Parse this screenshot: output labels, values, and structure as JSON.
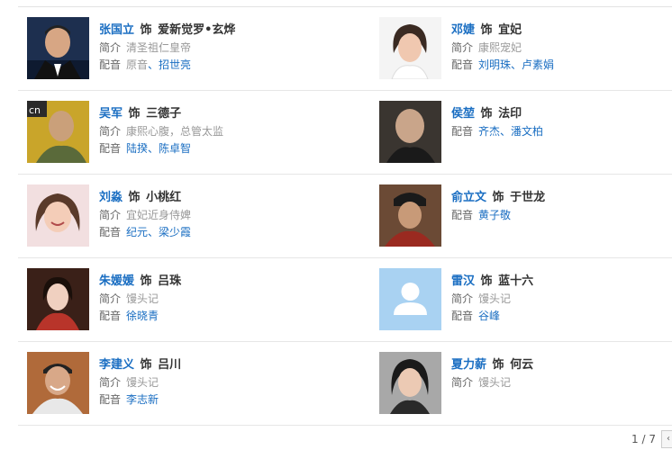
{
  "cast": [
    {
      "actor": "张国立",
      "role": "爱新觉罗•玄烨",
      "intro": "清圣祖仁皇帝",
      "voices": [
        "原音",
        "招世亮"
      ],
      "voice_first_plain": true,
      "avatar": "photo-man-suit"
    },
    {
      "actor": "邓婕",
      "role": "宜妃",
      "intro": "康熙宠妃",
      "voices": [
        "刘明珠",
        "卢素娟"
      ],
      "avatar": "photo-woman-short-hair"
    },
    {
      "actor": "吴军",
      "role": "三德子",
      "intro": "康熙心腹，总管太监",
      "voices": [
        "陆揆",
        "陈卓智"
      ],
      "avatar": "photo-bald-man-logo"
    },
    {
      "actor": "侯堃",
      "role": "法印",
      "intro": "",
      "voices": [
        "齐杰",
        "潘文柏"
      ],
      "avatar": "photo-bald-man-dark"
    },
    {
      "actor": "刘淼",
      "role": "小桃红",
      "intro": "宜妃近身侍婢",
      "voices": [
        "纪元",
        "梁少霞"
      ],
      "avatar": "photo-woman-smiling"
    },
    {
      "actor": "俞立文",
      "role": "于世龙",
      "intro": "",
      "voices": [
        "黄子敬"
      ],
      "avatar": "photo-man-costume"
    },
    {
      "actor": "朱媛媛",
      "role": "吕珠",
      "intro": "馒头记",
      "voices": [
        "徐晓青"
      ],
      "avatar": "photo-woman-red-dress"
    },
    {
      "actor": "雷汉",
      "role": "蓝十六",
      "intro": "馒头记",
      "voices": [
        "谷峰"
      ],
      "avatar": "default-user-icon"
    },
    {
      "actor": "李建义",
      "role": "吕川",
      "intro": "馒头记",
      "voices": [
        "李志新"
      ],
      "avatar": "photo-man-smiling"
    },
    {
      "actor": "夏力薪",
      "role": "何云",
      "intro": "馒头记",
      "voices": [],
      "avatar": "photo-woman-bob"
    }
  ],
  "labels": {
    "shi": "饰",
    "intro": "简介",
    "voice": "配音",
    "sep": "、"
  },
  "pager": {
    "text": "1 / 7",
    "prev": "‹"
  },
  "colors": {
    "link": "#1a6ec2",
    "divider": "#e6e6e6",
    "default_avatar_bg": "#a9d2f2"
  }
}
